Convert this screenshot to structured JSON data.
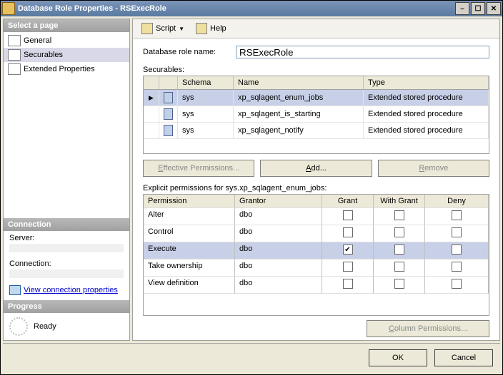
{
  "window": {
    "title": "Database Role Properties - RSExecRole"
  },
  "toolbar": {
    "script": "Script",
    "help": "Help"
  },
  "sidebar": {
    "select_page_header": "Select a page",
    "items": [
      "General",
      "Securables",
      "Extended Properties"
    ],
    "selected_index": 1,
    "connection_header": "Connection",
    "server_label": "Server:",
    "connection_label": "Connection:",
    "view_link": "View connection properties",
    "progress_header": "Progress",
    "progress_status": "Ready"
  },
  "main": {
    "role_label": "Database role name:",
    "role_value": "RSExecRole",
    "securables_label": "Securables:",
    "securables_columns": [
      "Schema",
      "Name",
      "Type"
    ],
    "securables": [
      {
        "schema": "sys",
        "name": "xp_sqlagent_enum_jobs",
        "type": "Extended stored procedure",
        "selected": true
      },
      {
        "schema": "sys",
        "name": "xp_sqlagent_is_starting",
        "type": "Extended stored procedure",
        "selected": false
      },
      {
        "schema": "sys",
        "name": "xp_sqlagent_notify",
        "type": "Extended stored procedure",
        "selected": false
      }
    ],
    "effective_btn": "Effective Permissions...",
    "add_btn": "Add...",
    "remove_btn": "Remove",
    "explicit_label": "Explicit permissions for sys.xp_sqlagent_enum_jobs:",
    "perm_columns": [
      "Permission",
      "Grantor",
      "Grant",
      "With Grant",
      "Deny"
    ],
    "permissions": [
      {
        "permission": "Alter",
        "grantor": "dbo",
        "grant": false,
        "withgrant": false,
        "deny": false,
        "selected": false
      },
      {
        "permission": "Control",
        "grantor": "dbo",
        "grant": false,
        "withgrant": false,
        "deny": false,
        "selected": false
      },
      {
        "permission": "Execute",
        "grantor": "dbo",
        "grant": true,
        "withgrant": false,
        "deny": false,
        "selected": true
      },
      {
        "permission": "Take ownership",
        "grantor": "dbo",
        "grant": false,
        "withgrant": false,
        "deny": false,
        "selected": false
      },
      {
        "permission": "View definition",
        "grantor": "dbo",
        "grant": false,
        "withgrant": false,
        "deny": false,
        "selected": false
      }
    ],
    "column_permissions_btn": "Column Permissions..."
  },
  "footer": {
    "ok": "OK",
    "cancel": "Cancel"
  }
}
